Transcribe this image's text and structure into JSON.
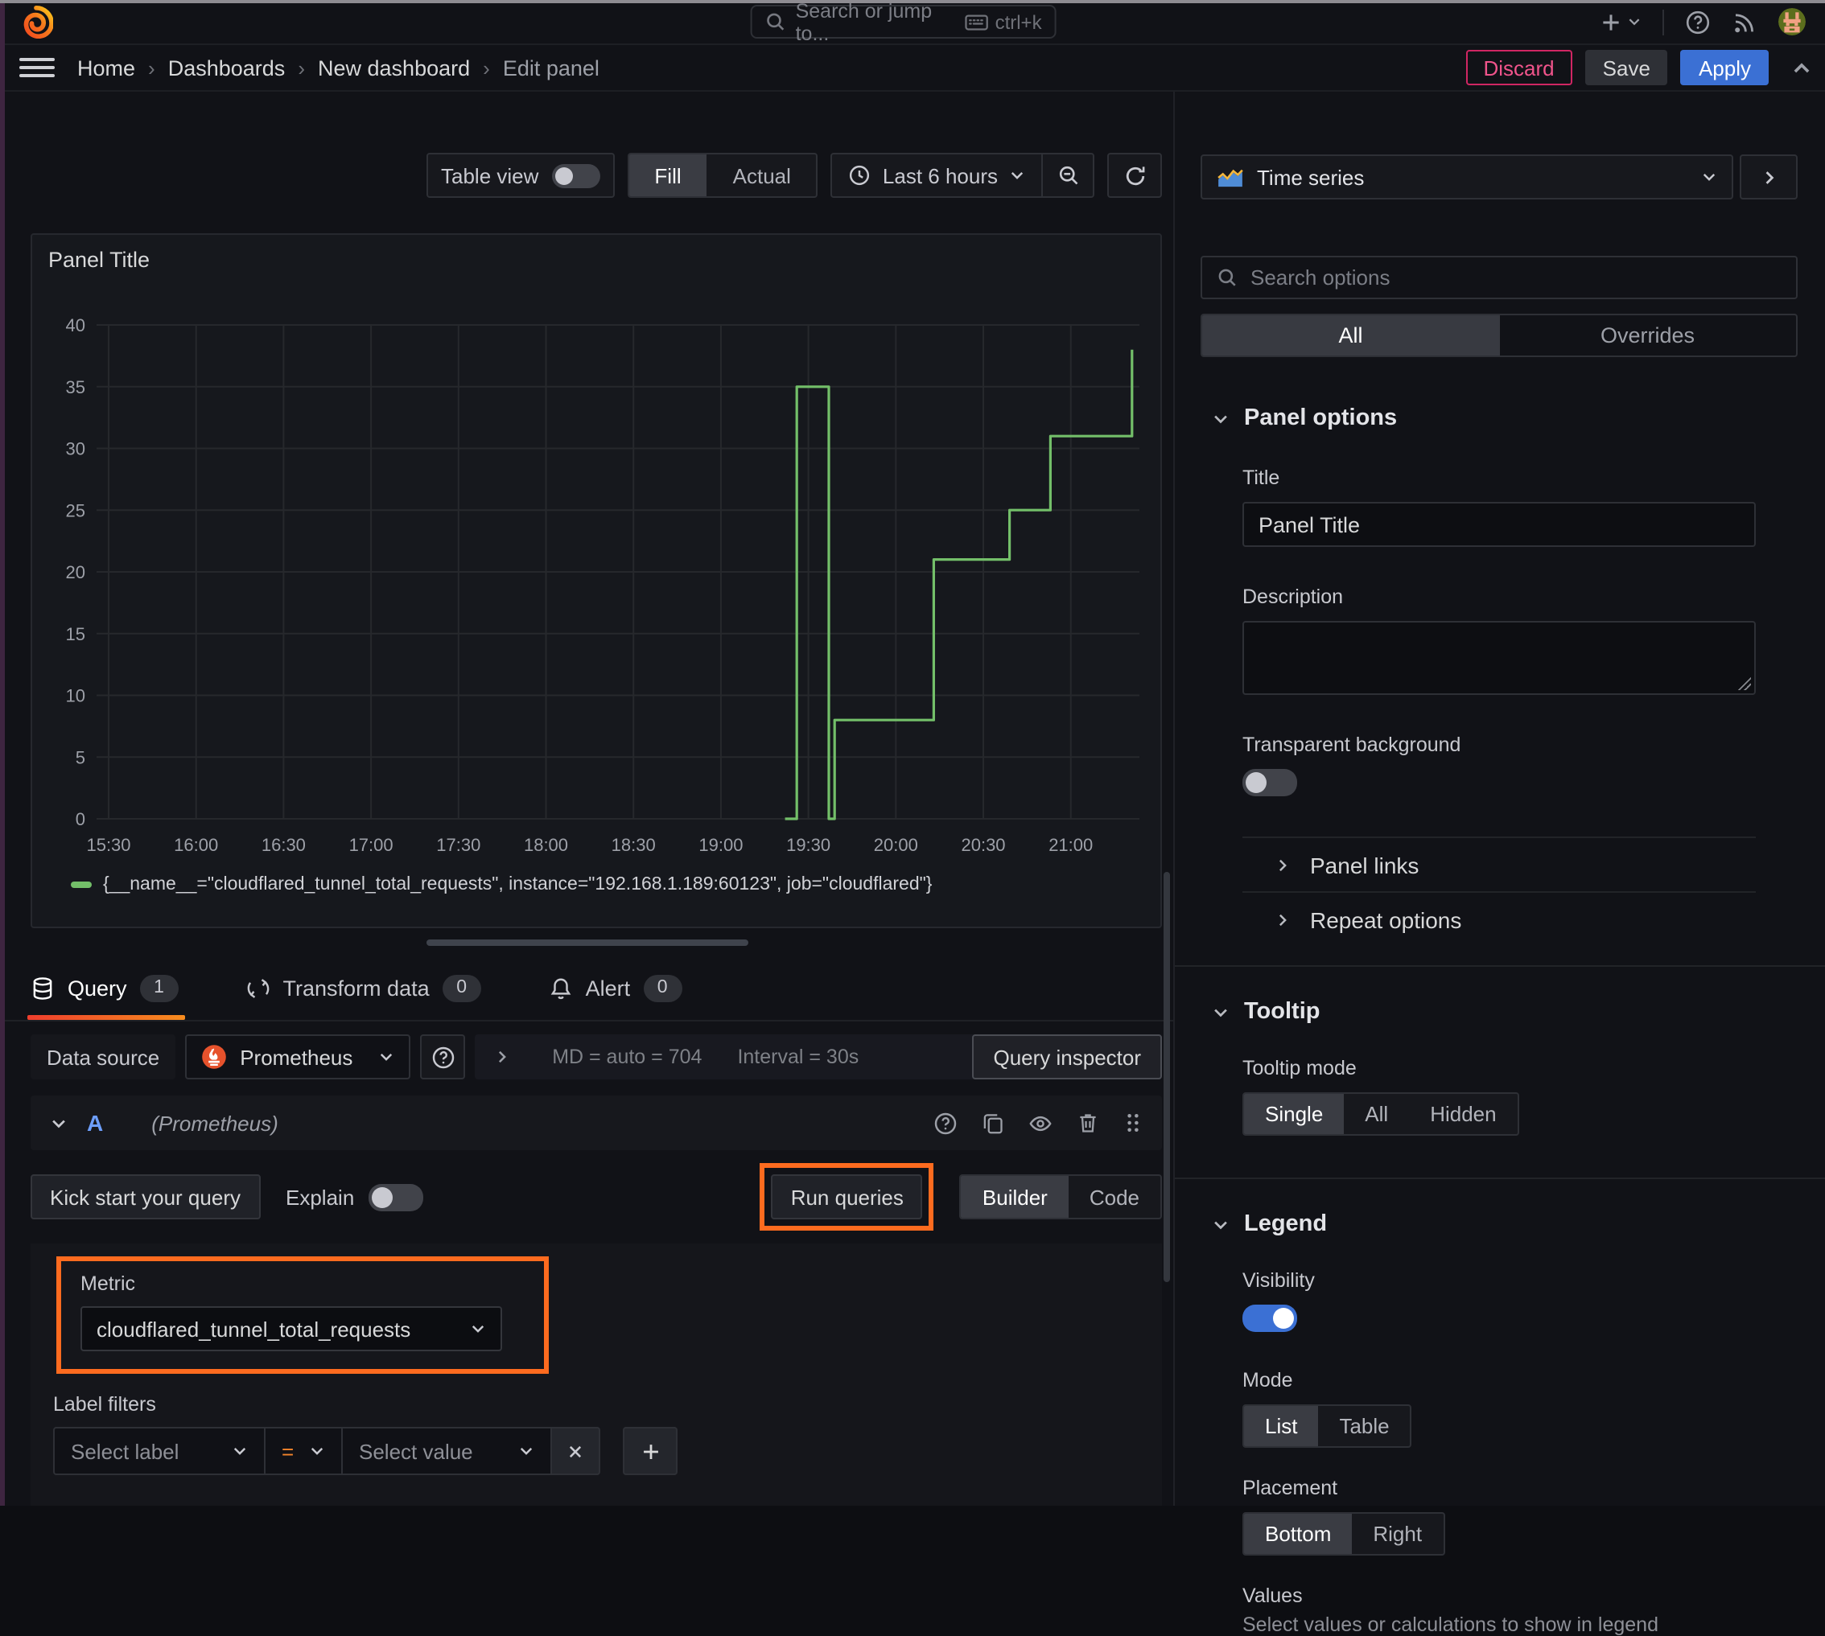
{
  "topbar": {
    "search_placeholder": "Search or jump to...",
    "shortcut": "ctrl+k"
  },
  "breadcrumb": {
    "items": [
      "Home",
      "Dashboards",
      "New dashboard",
      "Edit panel"
    ]
  },
  "header_actions": {
    "discard": "Discard",
    "save": "Save",
    "apply": "Apply"
  },
  "toolbar": {
    "table_view": "Table view",
    "fill": "Fill",
    "actual": "Actual",
    "time_range": "Last 6 hours"
  },
  "panel": {
    "title": "Panel Title"
  },
  "chart_data": {
    "type": "line",
    "title": "Panel Title",
    "xlabel": "",
    "ylabel": "",
    "x_ticks": [
      "15:30",
      "16:00",
      "16:30",
      "17:00",
      "17:30",
      "18:00",
      "18:30",
      "19:00",
      "19:30",
      "20:00",
      "20:30",
      "21:00"
    ],
    "x_tick_minutes": [
      930,
      960,
      990,
      1020,
      1050,
      1080,
      1110,
      1140,
      1170,
      1200,
      1230,
      1260
    ],
    "y_ticks": [
      0,
      5,
      10,
      15,
      20,
      25,
      30,
      35,
      40
    ],
    "y_range": [
      0,
      40
    ],
    "x_range_minutes": [
      926,
      1286
    ],
    "grid": true,
    "legend_position": "bottom",
    "series": [
      {
        "name": "{__name__=\"cloudflared_tunnel_total_requests\", instance=\"192.168.1.189:60123\", job=\"cloudflared\"}",
        "color": "#73BF69",
        "step_points": [
          [
            1162,
            0
          ],
          [
            1166,
            0
          ],
          [
            1166,
            35
          ],
          [
            1177,
            35
          ],
          [
            1177,
            0
          ],
          [
            1179,
            0
          ],
          [
            1179,
            8
          ],
          [
            1213,
            8
          ],
          [
            1213,
            21
          ],
          [
            1239,
            21
          ],
          [
            1239,
            25
          ],
          [
            1253,
            25
          ],
          [
            1253,
            31
          ],
          [
            1281,
            31
          ],
          [
            1281,
            38
          ]
        ]
      }
    ]
  },
  "tabs": {
    "query": {
      "label": "Query",
      "count": 1
    },
    "transform": {
      "label": "Transform data",
      "count": 0
    },
    "alert": {
      "label": "Alert",
      "count": 0
    }
  },
  "query_editor": {
    "datasource_label": "Data source",
    "datasource": "Prometheus",
    "stats": "MD = auto = 704",
    "interval": "Interval = 30s",
    "query_inspector": "Query inspector",
    "row_ref": "A",
    "row_ds": "(Prometheus)",
    "kick_start": "Kick start your query",
    "explain": "Explain",
    "run_queries": "Run queries",
    "builder": "Builder",
    "code": "Code",
    "metric_label": "Metric",
    "metric_value": "cloudflared_tunnel_total_requests",
    "label_filters_label": "Label filters",
    "select_label": "Select label",
    "operator": "=",
    "select_value": "Select value"
  },
  "sidebar": {
    "visualization": "Time series",
    "search_placeholder": "Search options",
    "tab_all": "All",
    "tab_overrides": "Overrides",
    "panel_options": {
      "title": "Panel options",
      "title_label": "Title",
      "title_value": "Panel Title",
      "description_label": "Description",
      "transparent_label": "Transparent background",
      "panel_links": "Panel links",
      "repeat_options": "Repeat options"
    },
    "tooltip": {
      "title": "Tooltip",
      "mode_label": "Tooltip mode",
      "options": [
        "Single",
        "All",
        "Hidden"
      ]
    },
    "legend": {
      "title": "Legend",
      "visibility_label": "Visibility",
      "mode_label": "Mode",
      "modes": [
        "List",
        "Table"
      ],
      "placement_label": "Placement",
      "placements": [
        "Bottom",
        "Right"
      ],
      "values_label": "Values",
      "values_hint": "Select values or calculations to show in legend"
    }
  },
  "colors": {
    "accent_orange": "#fd6b1f",
    "series_green": "#73BF69",
    "apply_blue": "#3b70d4",
    "discard_pink": "#f0548b",
    "toggle_on_blue": "#3b70d4"
  }
}
